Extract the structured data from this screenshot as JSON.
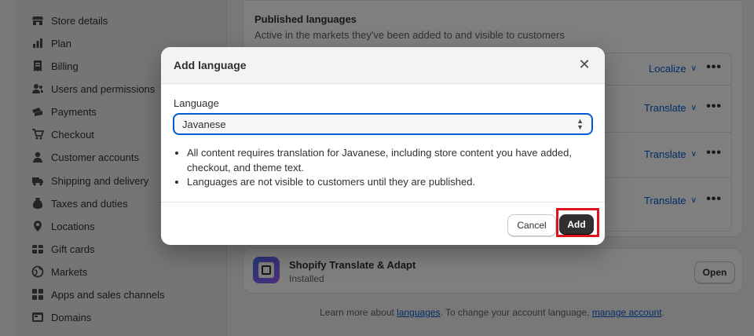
{
  "sidebar": {
    "items": [
      {
        "label": "Store details",
        "icon": "store-icon"
      },
      {
        "label": "Plan",
        "icon": "plan-icon"
      },
      {
        "label": "Billing",
        "icon": "billing-icon"
      },
      {
        "label": "Users and permissions",
        "icon": "users-icon"
      },
      {
        "label": "Payments",
        "icon": "payments-icon"
      },
      {
        "label": "Checkout",
        "icon": "cart-icon"
      },
      {
        "label": "Customer accounts",
        "icon": "person-icon"
      },
      {
        "label": "Shipping and delivery",
        "icon": "truck-icon"
      },
      {
        "label": "Taxes and duties",
        "icon": "tax-icon"
      },
      {
        "label": "Locations",
        "icon": "location-icon"
      },
      {
        "label": "Gift cards",
        "icon": "gift-icon"
      },
      {
        "label": "Markets",
        "icon": "globe-icon"
      },
      {
        "label": "Apps and sales channels",
        "icon": "apps-icon"
      },
      {
        "label": "Domains",
        "icon": "domains-icon"
      }
    ]
  },
  "published": {
    "title": "Published languages",
    "subtitle": "Active in the markets they've been added to and visible to customers",
    "rows": [
      {
        "action": "Localize"
      },
      {
        "action": "Translate"
      },
      {
        "action": "Translate"
      },
      {
        "action": "Translate"
      }
    ]
  },
  "app": {
    "name": "Shopify Translate & Adapt",
    "status": "Installed",
    "open_label": "Open"
  },
  "footer": {
    "prefix": "Learn more about ",
    "link1": "languages",
    "middle": ". To change your account language, ",
    "link2": "manage account",
    "suffix": "."
  },
  "modal": {
    "title": "Add language",
    "field_label": "Language",
    "selected_value": "Javanese",
    "bullets": [
      "All content requires translation for Javanese, including store content you have added, checkout, and theme text.",
      "Languages are not visible to customers until they are published."
    ],
    "cancel_label": "Cancel",
    "add_label": "Add"
  },
  "colors": {
    "accent": "#005bd3",
    "primary_button": "#303030",
    "highlight": "#e0121c"
  }
}
